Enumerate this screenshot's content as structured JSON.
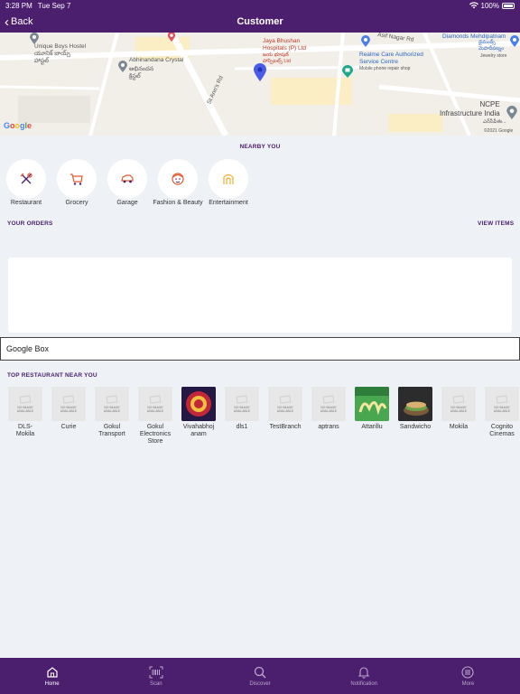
{
  "status": {
    "time": "3:28 PM",
    "date": "Tue Sep 7",
    "battery": "100%"
  },
  "nav": {
    "back_label": "Back",
    "title": "Customer"
  },
  "map": {
    "labels": {
      "unique_boys": "Unique Boys Hostel",
      "unique_boys_te": "యూనిక్ బాయ్స్\nహాస్టల్",
      "abhinandana": "Abhinandana Crystal",
      "abhinandana_te": "అభినందన\nక్రిస్టల్",
      "st_anns": "St Ann's Rd",
      "jaya_bhushan": "Jaya Bhushan\nHospitals (P) Ltd",
      "jaya_bhushan_te": "జయ భూషణ్\nహాస్పిటల్స్ Ltd",
      "asif_nagar": "Asif Nagar Rd",
      "realme": "Realme Care Authorized\nService Centre",
      "realme_sub": "Mobile phone repair shop",
      "diamonds": "Diamonds Mehdipatnam",
      "diamonds_te": "డైమండ్స్\nమెహదీపట్నం",
      "diamonds_sub": "Jewelry store",
      "ncpe": "NCPE\nInfrastructure India",
      "ncpe_te": "ఎన్‌సీపీఈ...",
      "copyright": "©2021 Google"
    },
    "logo": "Google"
  },
  "nearby": {
    "title": "NEARBY YOU",
    "categories": [
      {
        "label": "Restaurant",
        "icon": "utensils-icon"
      },
      {
        "label": "Grocery",
        "icon": "cart-icon"
      },
      {
        "label": "Garage",
        "icon": "car-icon"
      },
      {
        "label": "Fashion & Beauty",
        "icon": "face-icon"
      },
      {
        "label": "Entertainment",
        "icon": "theater-icon"
      }
    ]
  },
  "orders": {
    "title": "YOUR ORDERS",
    "view_items": "VIEW ITEMS"
  },
  "google_box": {
    "label": "Google Box"
  },
  "restaurants": {
    "title": "TOP RESTAURANT NEAR YOU",
    "no_image_text": "NO IMAGE\nAVAILABLE",
    "items": [
      {
        "name": "DLS-\nMokila",
        "image": "none"
      },
      {
        "name": "Curie",
        "image": "none"
      },
      {
        "name": "Gokul\nTransport",
        "image": "none"
      },
      {
        "name": "Gokul\nElectronics\nStore",
        "image": "none"
      },
      {
        "name": "Vivahabhoj\nanam",
        "image": "vivahabhojanam-logo"
      },
      {
        "name": "dls1",
        "image": "none"
      },
      {
        "name": "TestBranch",
        "image": "none"
      },
      {
        "name": "aptrans",
        "image": "none"
      },
      {
        "name": "Attarillu",
        "image": "attarillu-logo"
      },
      {
        "name": "Sandwicho",
        "image": "sandwicho-photo"
      },
      {
        "name": "Mokila",
        "image": "none"
      },
      {
        "name": "Cognito\nCinemas",
        "image": "none"
      }
    ]
  },
  "tabs": [
    {
      "label": "Home",
      "icon": "home-icon",
      "active": true
    },
    {
      "label": "Scan",
      "icon": "barcode-icon",
      "active": false
    },
    {
      "label": "Discover",
      "icon": "search-icon",
      "active": false
    },
    {
      "label": "Notification",
      "icon": "bell-icon",
      "active": false
    },
    {
      "label": "More",
      "icon": "menu-icon",
      "active": false
    }
  ],
  "colors": {
    "brand": "#4b1e6e",
    "accent": "#e2572f",
    "background": "#eef1f5"
  }
}
